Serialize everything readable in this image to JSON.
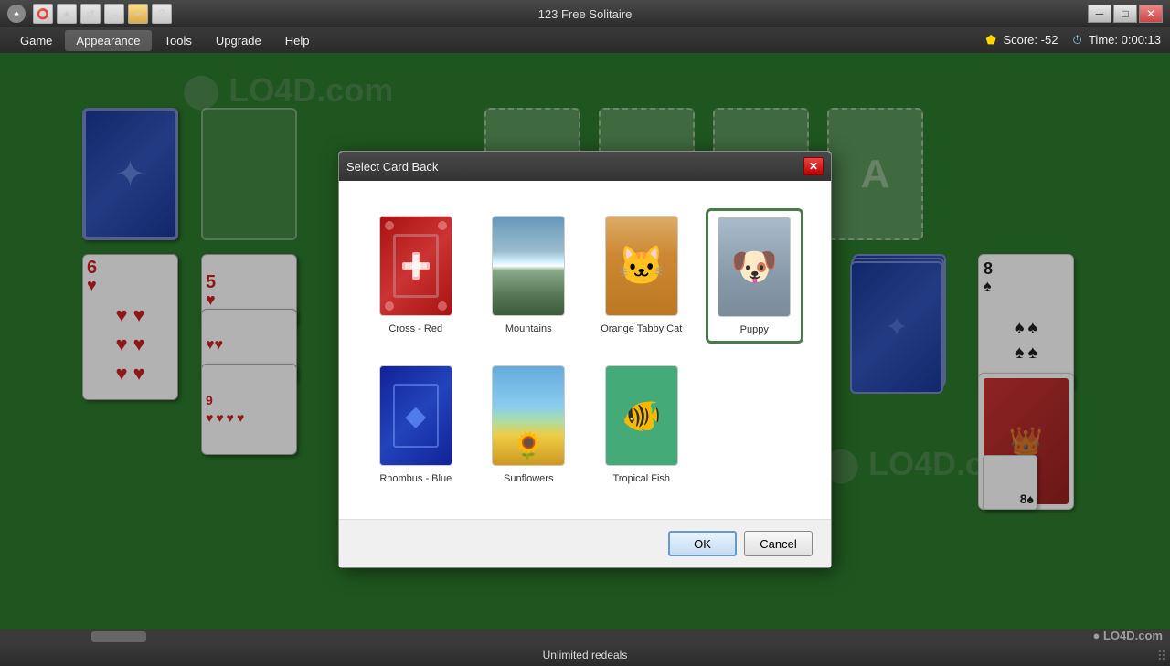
{
  "window": {
    "title": "123 Free Solitaire",
    "score_label": "Score:",
    "score_value": "-52",
    "time_label": "Time:",
    "time_value": "0:00:13"
  },
  "toolbar_icons": [
    "yellow-circle",
    "up-arrow",
    "refresh",
    "forward",
    "pencil",
    "question",
    "separator"
  ],
  "menu": {
    "items": [
      "Game",
      "Appearance",
      "Tools",
      "Upgrade",
      "Help"
    ]
  },
  "dialog": {
    "title": "Select Card Back",
    "close_btn": "✕",
    "cards": [
      {
        "id": "cross-red",
        "label": "Cross - Red",
        "selected": false
      },
      {
        "id": "mountains",
        "label": "Mountains",
        "selected": false
      },
      {
        "id": "orange-tabby-cat",
        "label": "Orange Tabby Cat",
        "selected": false
      },
      {
        "id": "puppy",
        "label": "Puppy",
        "selected": true
      },
      {
        "id": "rhombus-blue",
        "label": "Rhombus - Blue",
        "selected": false
      },
      {
        "id": "sunflowers",
        "label": "Sunflowers",
        "selected": false
      },
      {
        "id": "tropical-fish",
        "label": "Tropical Fish",
        "selected": false
      }
    ],
    "ok_label": "OK",
    "cancel_label": "Cancel"
  },
  "status_bar": {
    "text": "Unlimited redeals"
  },
  "game": {
    "stock_card": "back",
    "foundation_symbol": "A",
    "col1_rank": "6",
    "col1_suit": "♥",
    "col2_rank": "5",
    "col2_suit": "♥",
    "right1_rank": "8",
    "right1_suit": "♠",
    "right2_rank": "8",
    "right2_suit": "♠"
  }
}
